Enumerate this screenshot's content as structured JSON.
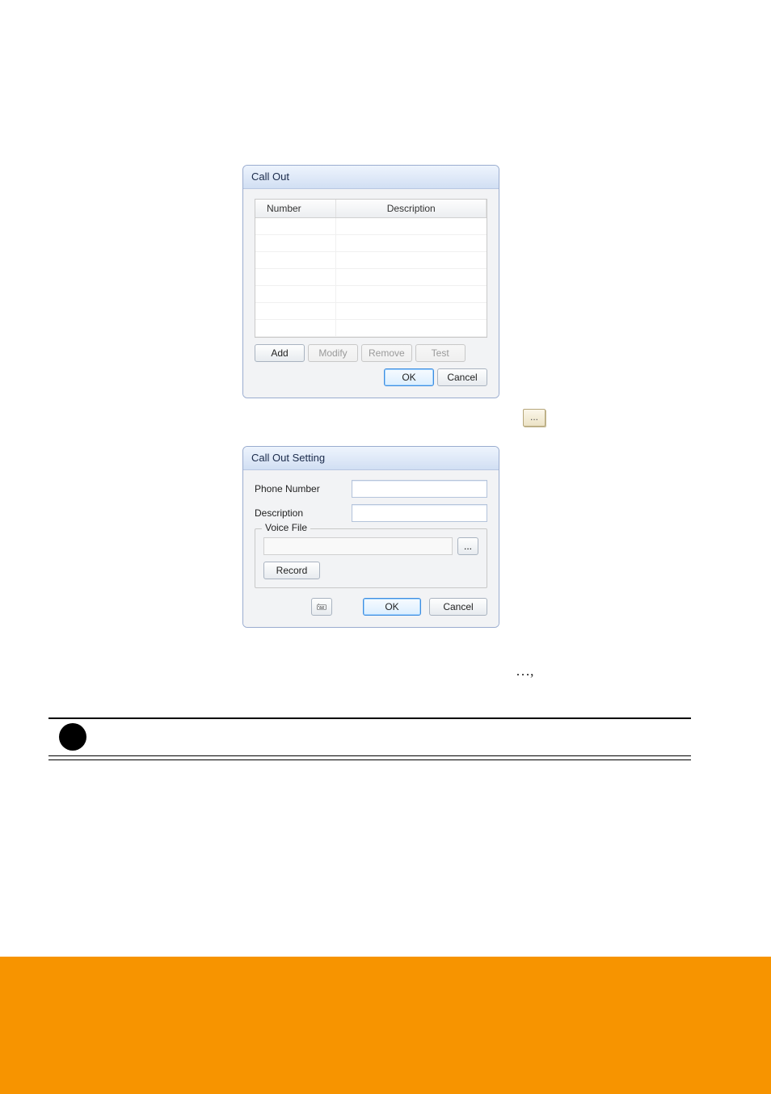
{
  "callout": {
    "title": "Call Out",
    "columns": {
      "number": "Number",
      "description": "Description"
    },
    "rows": [],
    "buttons": {
      "add": "Add",
      "modify": "Modify",
      "remove": "Remove",
      "test": "Test",
      "ok": "OK",
      "cancel": "Cancel"
    }
  },
  "browse_icon_label": "...",
  "setting": {
    "title": "Call Out Setting",
    "phone_label": "Phone Number",
    "phone_value": "",
    "desc_label": "Description",
    "desc_value": "",
    "voice_legend": "Voice File",
    "voice_path": "",
    "browse_label": "...",
    "record": "Record",
    "ok": "OK",
    "cancel": "Cancel"
  },
  "doc_text": {
    "ellipsis_comma": "…,"
  },
  "icons": {
    "keyboard": "keyboard-icon",
    "bullet": "bullet-icon"
  }
}
